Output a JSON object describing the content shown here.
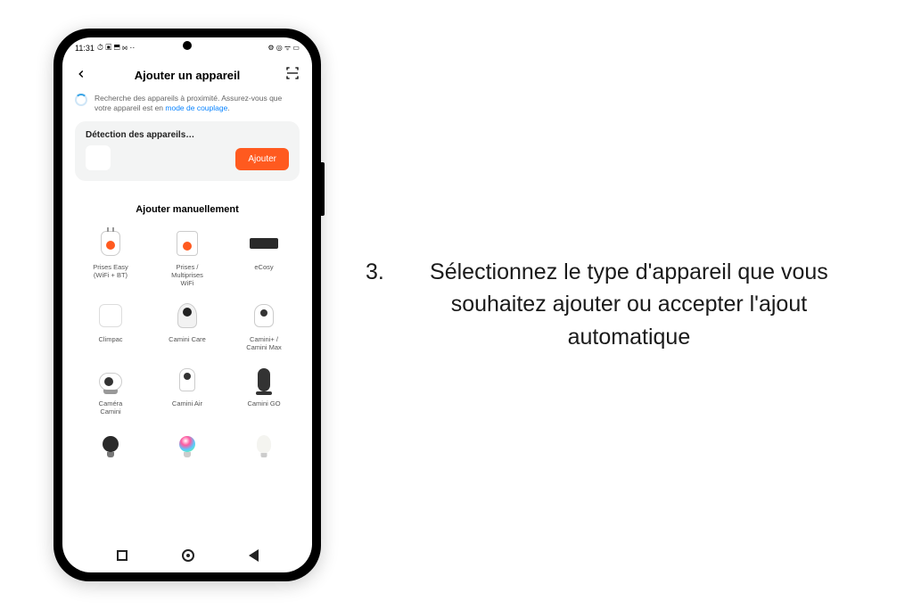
{
  "statusBar": {
    "time": "11:31",
    "leftIcons": "⏱ ▣ ⬒ ⋈ ··",
    "rightIcons": "⚙ ◎ ᯤ ▭"
  },
  "header": {
    "title": "Ajouter un appareil"
  },
  "banner": {
    "text1": "Recherche des appareils à proximité. Assurez-vous que votre appareil est en ",
    "linkText": "mode de couplage",
    "text2": "."
  },
  "detectCard": {
    "title": "Détection des appareils…",
    "button": "Ajouter"
  },
  "manualSection": {
    "title": "Ajouter manuellement",
    "devices": [
      {
        "label": "Prises Easy\n(WiFi + BT)",
        "shape": "plug"
      },
      {
        "label": "Prises /\nMultiprises\nWiFi",
        "shape": "multiplug"
      },
      {
        "label": "eCosy",
        "shape": "ecosy"
      },
      {
        "label": "Climpac",
        "shape": "climpac"
      },
      {
        "label": "Camini Care",
        "shape": "camera1"
      },
      {
        "label": "Camini+ /\nCamini Max",
        "shape": "camera2"
      },
      {
        "label": "Caméra\nCamini",
        "shape": "camera3"
      },
      {
        "label": "Camini Air",
        "shape": "camera4"
      },
      {
        "label": "Camini GO",
        "shape": "camera5"
      },
      {
        "label": "",
        "shape": "bulb-dark"
      },
      {
        "label": "",
        "shape": "bulb-rgb"
      },
      {
        "label": "",
        "shape": "bulb-white"
      }
    ]
  },
  "instruction": {
    "number": "3.",
    "text": "Sélectionnez le type d'appareil que vous souhaitez ajouter ou accepter l'ajout automatique"
  }
}
